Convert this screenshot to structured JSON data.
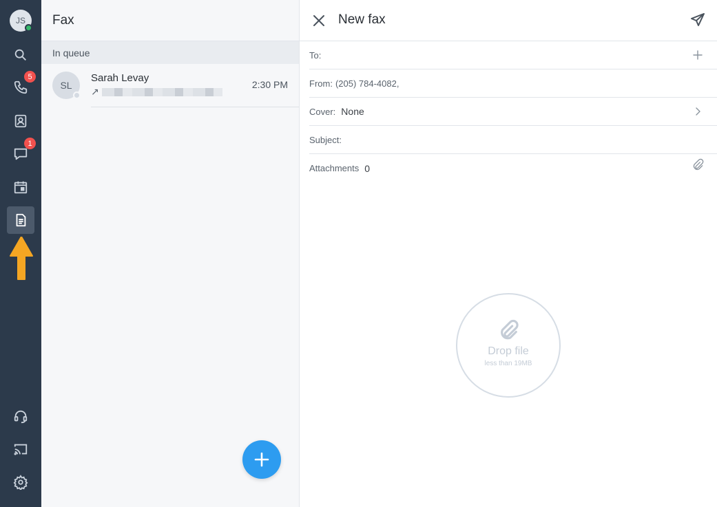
{
  "sidebar": {
    "avatar_initials": "JS",
    "calls_badge": "5",
    "messages_badge": "1",
    "icons": [
      "search-icon",
      "phone-icon",
      "contacts-icon",
      "chat-icon",
      "calendar-icon",
      "fax-icon",
      "headset-icon",
      "cast-icon",
      "gear-icon"
    ],
    "active_item": "fax",
    "arrow_color": "#f5a623"
  },
  "list": {
    "title": "Fax",
    "section_label": "In queue",
    "items": [
      {
        "initials": "SL",
        "name": "Sarah Levay",
        "direction": "↗",
        "time": "2:30 PM"
      }
    ],
    "fab_label": "+"
  },
  "form": {
    "title": "New fax",
    "to_label": "To:",
    "from_label": "From:",
    "from_value": "(205) 784-4082,",
    "cover_label": "Cover:",
    "cover_value": "None",
    "subject_label": "Subject:",
    "attachments_label": "Attachments",
    "attachments_count": "0",
    "drop_title": "Drop file",
    "drop_hint": "less than 19MB"
  },
  "colors": {
    "sidebar_bg": "#2c3a4b",
    "accent": "#2d9cf0",
    "badge": "#f2514e",
    "online": "#36b86b"
  }
}
